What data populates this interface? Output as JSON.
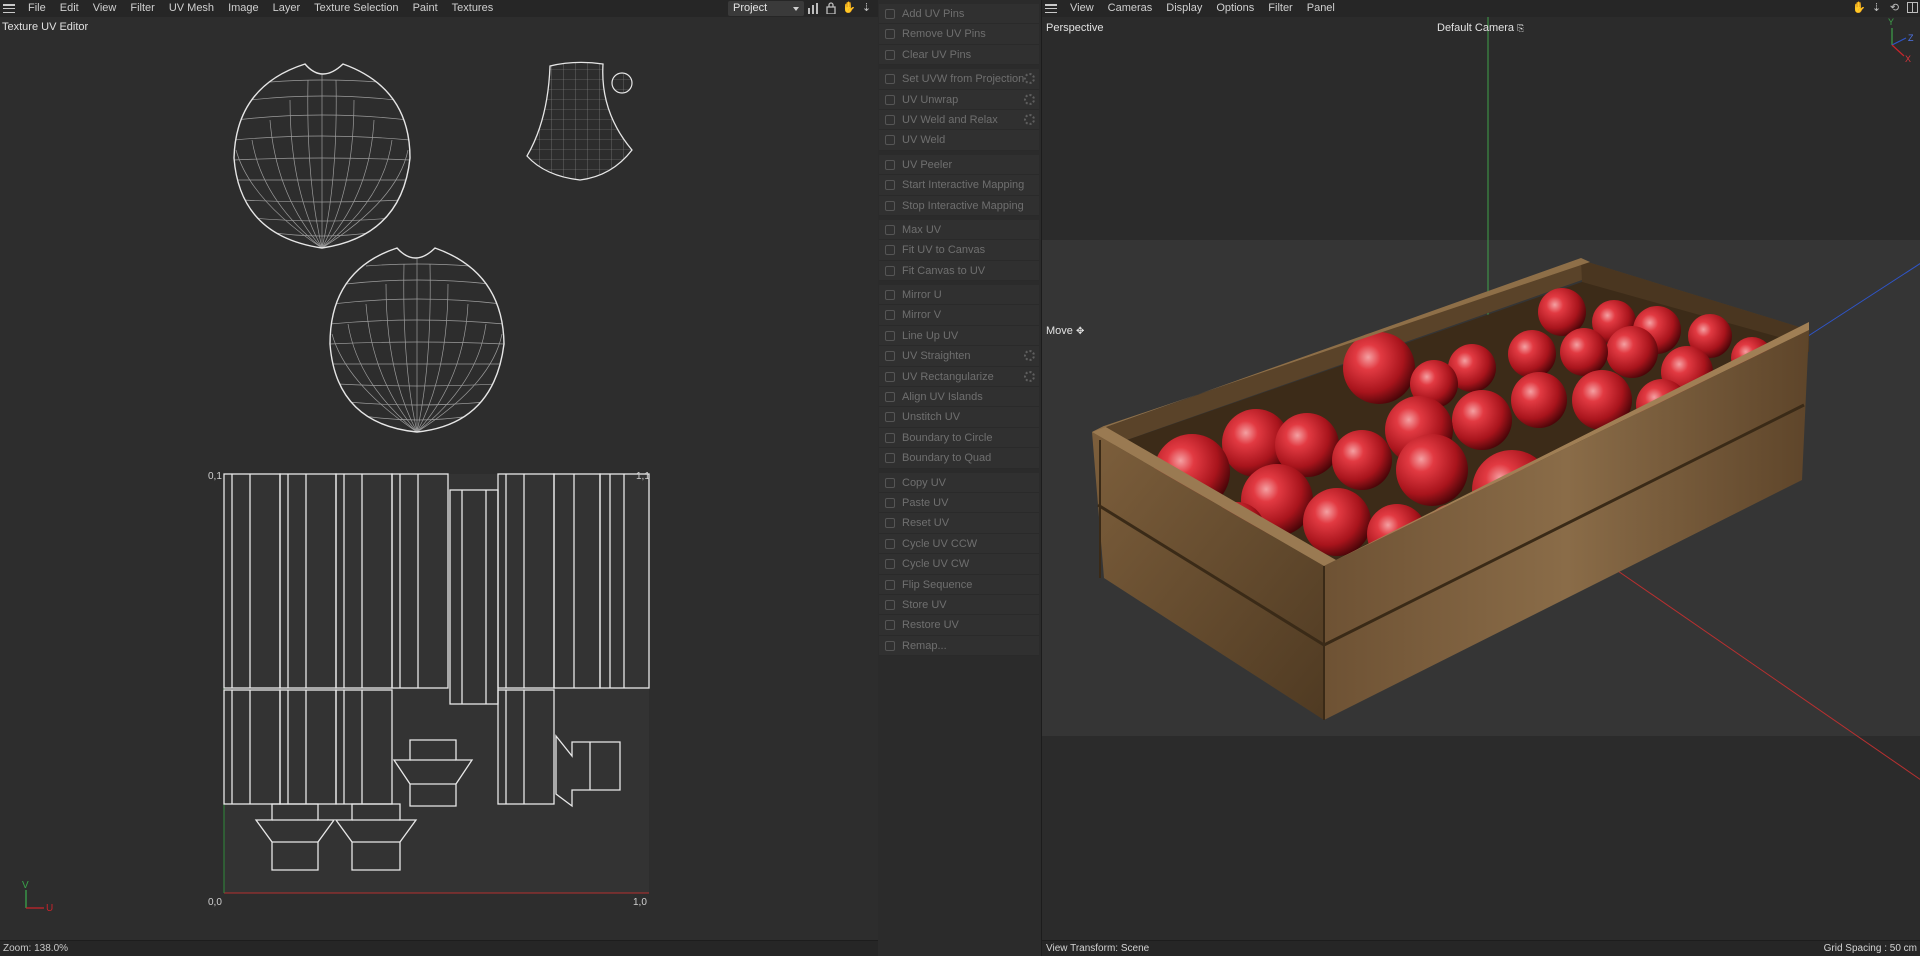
{
  "uv_editor": {
    "menu": [
      {
        "id": "file",
        "label": "File"
      },
      {
        "id": "edit",
        "label": "Edit"
      },
      {
        "id": "view",
        "label": "View"
      },
      {
        "id": "filter",
        "label": "Filter"
      },
      {
        "id": "uv-mesh",
        "label": "UV Mesh"
      },
      {
        "id": "image",
        "label": "Image"
      },
      {
        "id": "layer",
        "label": "Layer"
      },
      {
        "id": "texture-selection",
        "label": "Texture Selection"
      },
      {
        "id": "paint",
        "label": "Paint"
      },
      {
        "id": "textures",
        "label": "Textures"
      }
    ],
    "title": "Texture UV Editor",
    "project_select": "Project",
    "toolbar_icons": [
      "bar-chart-icon",
      "lock-icon",
      "hand-icon",
      "move-down-icon"
    ],
    "axis": {
      "origin": "0,0",
      "u_max": "1,0",
      "v_max": "0,1",
      "corner": "1,1",
      "v": "V",
      "u": "U"
    },
    "zoom": "Zoom: 138.0%"
  },
  "uv_tools": {
    "groups": [
      [
        {
          "label": "Add UV Pins",
          "icon": "pin-add-icon",
          "gear": false
        },
        {
          "label": "Remove UV Pins",
          "icon": "pin-remove-icon",
          "gear": false
        },
        {
          "label": "Clear UV Pins",
          "icon": "pin-clear-icon",
          "gear": false
        }
      ],
      [
        {
          "label": "Set UVW from Projection",
          "icon": "projection-icon",
          "gear": true
        },
        {
          "label": "UV Unwrap",
          "icon": "unwrap-icon",
          "gear": true
        },
        {
          "label": "UV Weld and Relax",
          "icon": "weld-relax-icon",
          "gear": true
        },
        {
          "label": "UV Weld",
          "icon": "weld-icon",
          "gear": false
        }
      ],
      [
        {
          "label": "UV Peeler",
          "icon": "peeler-icon",
          "gear": false
        },
        {
          "label": "Start Interactive Mapping",
          "icon": "play-icon",
          "gear": false
        },
        {
          "label": "Stop Interactive Mapping",
          "icon": "stop-icon",
          "gear": false
        }
      ],
      [
        {
          "label": "Max UV",
          "icon": "max-uv-icon",
          "gear": false
        },
        {
          "label": "Fit UV to Canvas",
          "icon": "fit-uv-icon",
          "gear": false
        },
        {
          "label": "Fit Canvas to UV",
          "icon": "fit-canvas-icon",
          "gear": false
        }
      ],
      [
        {
          "label": "Mirror U",
          "icon": "mirror-u-icon",
          "gear": false
        },
        {
          "label": "Mirror V",
          "icon": "mirror-v-icon",
          "gear": false
        },
        {
          "label": "Line Up UV",
          "icon": "line-up-icon",
          "gear": false
        },
        {
          "label": "UV Straighten",
          "icon": "straighten-icon",
          "gear": true
        },
        {
          "label": "UV Rectangularize",
          "icon": "rectangularize-icon",
          "gear": true
        },
        {
          "label": "Align UV Islands",
          "icon": "align-icon",
          "gear": false
        },
        {
          "label": "Unstitch UV",
          "icon": "unstitch-icon",
          "gear": false
        },
        {
          "label": "Boundary to Circle",
          "icon": "circle-icon",
          "gear": false
        },
        {
          "label": "Boundary to Quad",
          "icon": "quad-icon",
          "gear": false
        }
      ],
      [
        {
          "label": "Copy UV",
          "icon": "copy-icon",
          "gear": false
        },
        {
          "label": "Paste UV",
          "icon": "paste-icon",
          "gear": false
        },
        {
          "label": "Reset UV",
          "icon": "reset-icon",
          "gear": false
        },
        {
          "label": "Cycle UV CCW",
          "icon": "cycle-ccw-icon",
          "gear": false
        },
        {
          "label": "Cycle UV CW",
          "icon": "cycle-cw-icon",
          "gear": false
        },
        {
          "label": "Flip Sequence",
          "icon": "flip-icon",
          "gear": false
        },
        {
          "label": "Store UV",
          "icon": "store-icon",
          "gear": false
        },
        {
          "label": "Restore UV",
          "icon": "restore-icon",
          "gear": false
        },
        {
          "label": "Remap...",
          "icon": "remap-icon",
          "gear": false
        }
      ]
    ]
  },
  "viewport": {
    "menu": [
      {
        "id": "view",
        "label": "View"
      },
      {
        "id": "cameras",
        "label": "Cameras"
      },
      {
        "id": "display",
        "label": "Display"
      },
      {
        "id": "options",
        "label": "Options"
      },
      {
        "id": "filter",
        "label": "Filter"
      },
      {
        "id": "panel",
        "label": "Panel"
      }
    ],
    "perspective": "Perspective",
    "camera": "Default Camera",
    "move": "Move",
    "view_transform": "View Transform: Scene",
    "grid_spacing": "Grid Spacing : 50 cm",
    "axis_labels": {
      "y": "Y",
      "z": "Z",
      "x": "X"
    },
    "toolbar_icons": [
      "hand-icon",
      "move-down-icon",
      "rotate-icon",
      "layout-icon"
    ]
  },
  "colors": {
    "accent_red": "#c8242b",
    "wood": "#7a5c3a",
    "bg": "#2b2b2b"
  }
}
